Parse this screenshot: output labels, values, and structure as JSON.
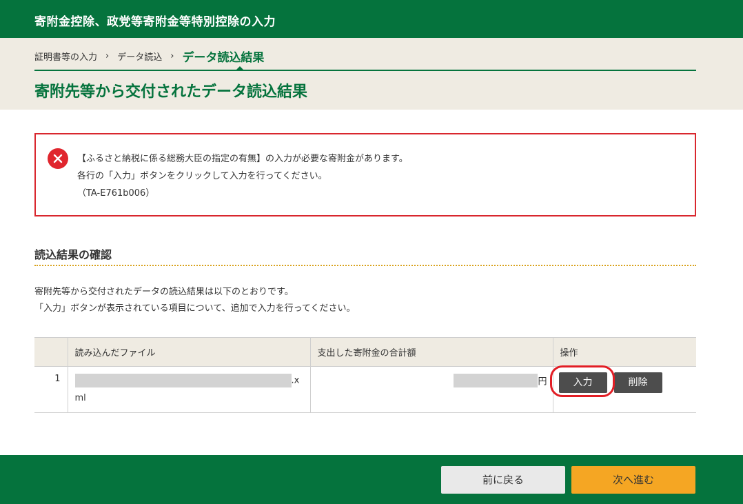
{
  "header": {
    "title": "寄附金控除、政党等寄附金等特別控除の入力"
  },
  "breadcrumb": {
    "step1": "証明書等の入力",
    "step2": "データ読込",
    "current": "データ読込結果",
    "separator": "›"
  },
  "page": {
    "heading": "寄附先等から交付されたデータ読込結果"
  },
  "error": {
    "line1": "【ふるさと納税に係る総務大臣の指定の有無】の入力が必要な寄附金があります。",
    "line2": "各行の「入力」ボタンをクリックして入力を行ってください。",
    "code": "（TA-E761b006）",
    "color": "#d9272e"
  },
  "section": {
    "title": "読込結果の確認",
    "intro_line1": "寄附先等から交付されたデータの読込結果は以下のとおりです。",
    "intro_line2": "「入力」ボタンが表示されている項目について、追加で入力を行ってください。"
  },
  "table": {
    "headers": [
      "",
      "読み込んだファイル",
      "支出した寄附金の合計額",
      "操作"
    ],
    "rows": [
      {
        "num": "1",
        "file_ext": ".x",
        "file_line2": "ml",
        "amount_unit": "円",
        "input_label": "入力",
        "delete_label": "削除"
      }
    ]
  },
  "footer": {
    "back_label": "前に戻る",
    "next_label": "次へ進む"
  },
  "colors": {
    "brand_green": "#05733d",
    "next_orange": "#f5a623",
    "band_beige": "#efebe2"
  }
}
